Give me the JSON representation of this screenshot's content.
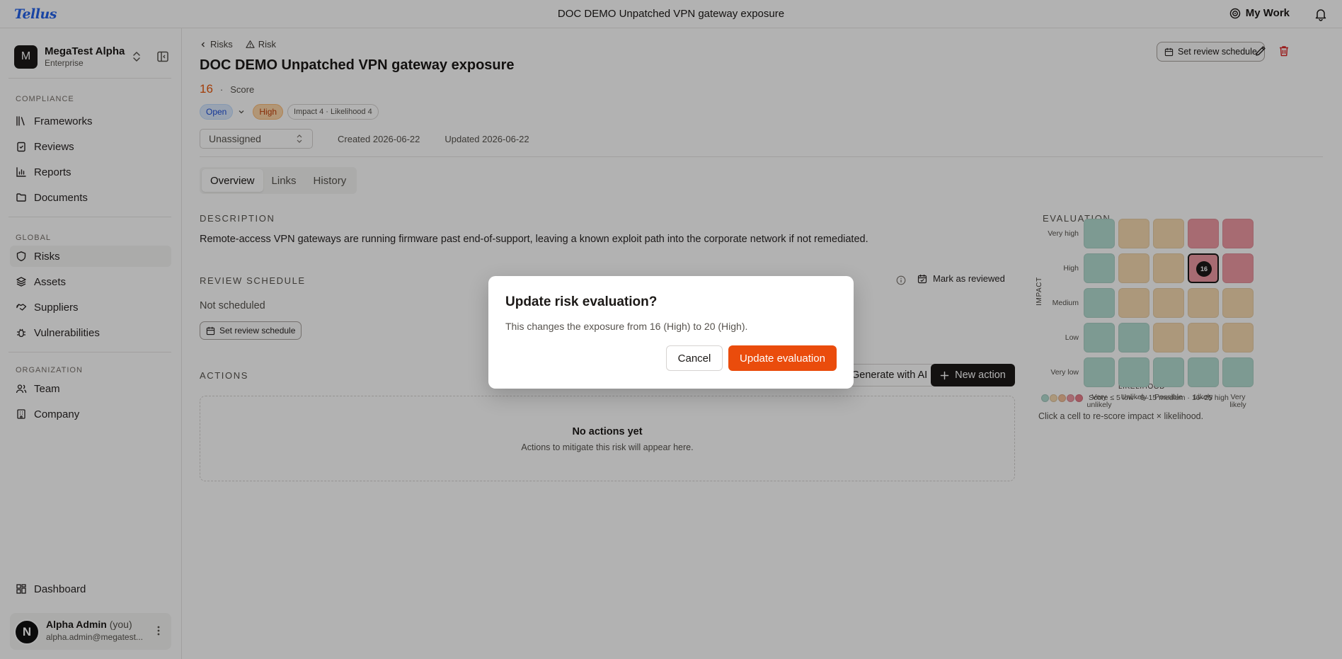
{
  "app": {
    "logo_text": "Tellus",
    "window_title": "DOC DEMO Unpatched VPN gateway exposure",
    "my_work_label": "My Work"
  },
  "sidebar": {
    "org_initial": "M",
    "org_name": "MegaTest Alpha",
    "org_plan": "Enterprise",
    "sections": [
      {
        "label": "COMPLIANCE",
        "items": [
          {
            "label": "Frameworks",
            "icon": "library-icon"
          },
          {
            "label": "Reviews",
            "icon": "clipboard-check-icon"
          },
          {
            "label": "Reports",
            "icon": "bar-chart-icon"
          },
          {
            "label": "Documents",
            "icon": "folder-icon"
          }
        ]
      },
      {
        "label": "GLOBAL",
        "items": [
          {
            "label": "Risks",
            "icon": "shield-icon",
            "active": true
          },
          {
            "label": "Assets",
            "icon": "layers-icon"
          },
          {
            "label": "Suppliers",
            "icon": "handshake-icon"
          },
          {
            "label": "Vulnerabilities",
            "icon": "bug-icon"
          }
        ]
      },
      {
        "label": "ORGANIZATION",
        "items": [
          {
            "label": "Team",
            "icon": "users-icon"
          },
          {
            "label": "Company",
            "icon": "building-icon"
          }
        ]
      }
    ],
    "dashboard_label": "Dashboard",
    "user": {
      "initial": "N",
      "name": "Alpha Admin",
      "you_tag": "(you)",
      "email": "alpha.admin@megatest..."
    }
  },
  "breadcrumb": {
    "items": [
      "Risks",
      "Risk"
    ]
  },
  "risk": {
    "title": "DOC DEMO Unpatched VPN gateway exposure",
    "score": "16",
    "score_label": "Score",
    "status": "Open",
    "severity": "High",
    "impact_likelihood": "Impact 4 · Likelihood 4",
    "assignee_placeholder": "Unassigned",
    "created": "Created 2026-06-22",
    "updated": "Updated 2026-06-22"
  },
  "header_actions": {
    "set_review_label": "Set review schedule"
  },
  "tabs": [
    {
      "label": "Overview",
      "active": true
    },
    {
      "label": "Links",
      "active": false
    },
    {
      "label": "History",
      "active": false
    }
  ],
  "description": {
    "heading": "DESCRIPTION",
    "text": "Remote-access VPN gateways are running firmware past end-of-support, leaving a known exploit path into the corporate network if not remediated."
  },
  "review_schedule": {
    "heading": "REVIEW SCHEDULE",
    "status": "Not scheduled",
    "set_label": "Set review schedule",
    "mark_reviewed_label": "Mark as reviewed"
  },
  "actions": {
    "heading": "ACTIONS",
    "generate_ai_label": "Generate with AI",
    "new_action_label": "New action",
    "empty_title": "No actions yet",
    "empty_sub": "Actions to mitigate this risk will appear here."
  },
  "evaluation": {
    "heading": "EVALUATION",
    "impact_axis": "IMPACT",
    "likelihood_axis": "LIKELIHOOD",
    "impact_levels": [
      "Very high",
      "High",
      "Medium",
      "Low",
      "Very low"
    ],
    "likelihood_levels": [
      [
        "Very",
        "unlikely"
      ],
      [
        "Unlikely",
        ""
      ],
      [
        "Possible",
        ""
      ],
      [
        "Likely",
        ""
      ],
      [
        "Very",
        "likely"
      ]
    ],
    "grid_colors": [
      [
        "green",
        "amber",
        "amber",
        "red",
        "red"
      ],
      [
        "green",
        "amber",
        "amber",
        "red",
        "red"
      ],
      [
        "green",
        "amber",
        "amber",
        "amber",
        "amber"
      ],
      [
        "green",
        "green",
        "amber",
        "amber",
        "amber"
      ],
      [
        "green",
        "green",
        "green",
        "green",
        "green"
      ]
    ],
    "selected": {
      "impact": "High",
      "likelihood": "Likely",
      "score": "16"
    },
    "legend_text": "Score ≤ 5 low · 6–15 medium · 16–25 high",
    "legend_colors": [
      "#b4ddd2",
      "#f7dab0",
      "#f5c19a",
      "#f09aa4",
      "#ea7f8c"
    ],
    "hint": "Click a cell to re-score impact × likelihood."
  },
  "modal": {
    "title": "Update risk evaluation?",
    "body": "This changes the exposure from 16 (High) to 20 (High).",
    "cancel_label": "Cancel",
    "confirm_label": "Update evaluation"
  },
  "colors": {
    "accent": "#ea4c0c",
    "brand": "#2563eb",
    "overlay": "rgba(0,0,0,0.30)"
  }
}
